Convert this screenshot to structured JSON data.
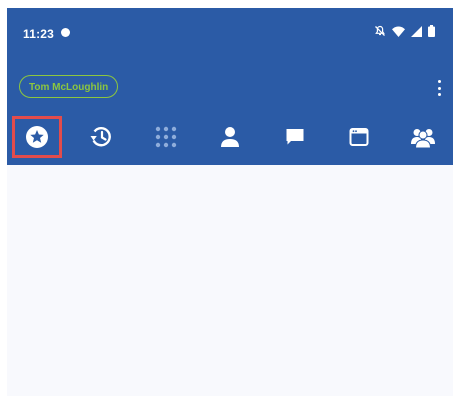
{
  "status_bar": {
    "time": "11:23",
    "icons": [
      "recording-dot-icon",
      "mute-icon",
      "wifi-icon",
      "signal-icon",
      "battery-icon"
    ]
  },
  "account": {
    "name": "Tom McLoughlin",
    "chip_color": "#8cc63f"
  },
  "tabs": [
    {
      "icon": "favorites-star-icon",
      "selected": true
    },
    {
      "icon": "recent-history-icon",
      "selected": false
    },
    {
      "icon": "dialpad-icon",
      "selected": false
    },
    {
      "icon": "contact-person-icon",
      "selected": false
    },
    {
      "icon": "chat-icon",
      "selected": false
    },
    {
      "icon": "browser-window-icon",
      "selected": false
    },
    {
      "icon": "group-people-icon",
      "selected": false
    }
  ],
  "colors": {
    "app_bar": "#2b5ba6",
    "content_background": "#f8f9fd",
    "highlight": "#e24c4c",
    "icon": "#ffffff"
  }
}
